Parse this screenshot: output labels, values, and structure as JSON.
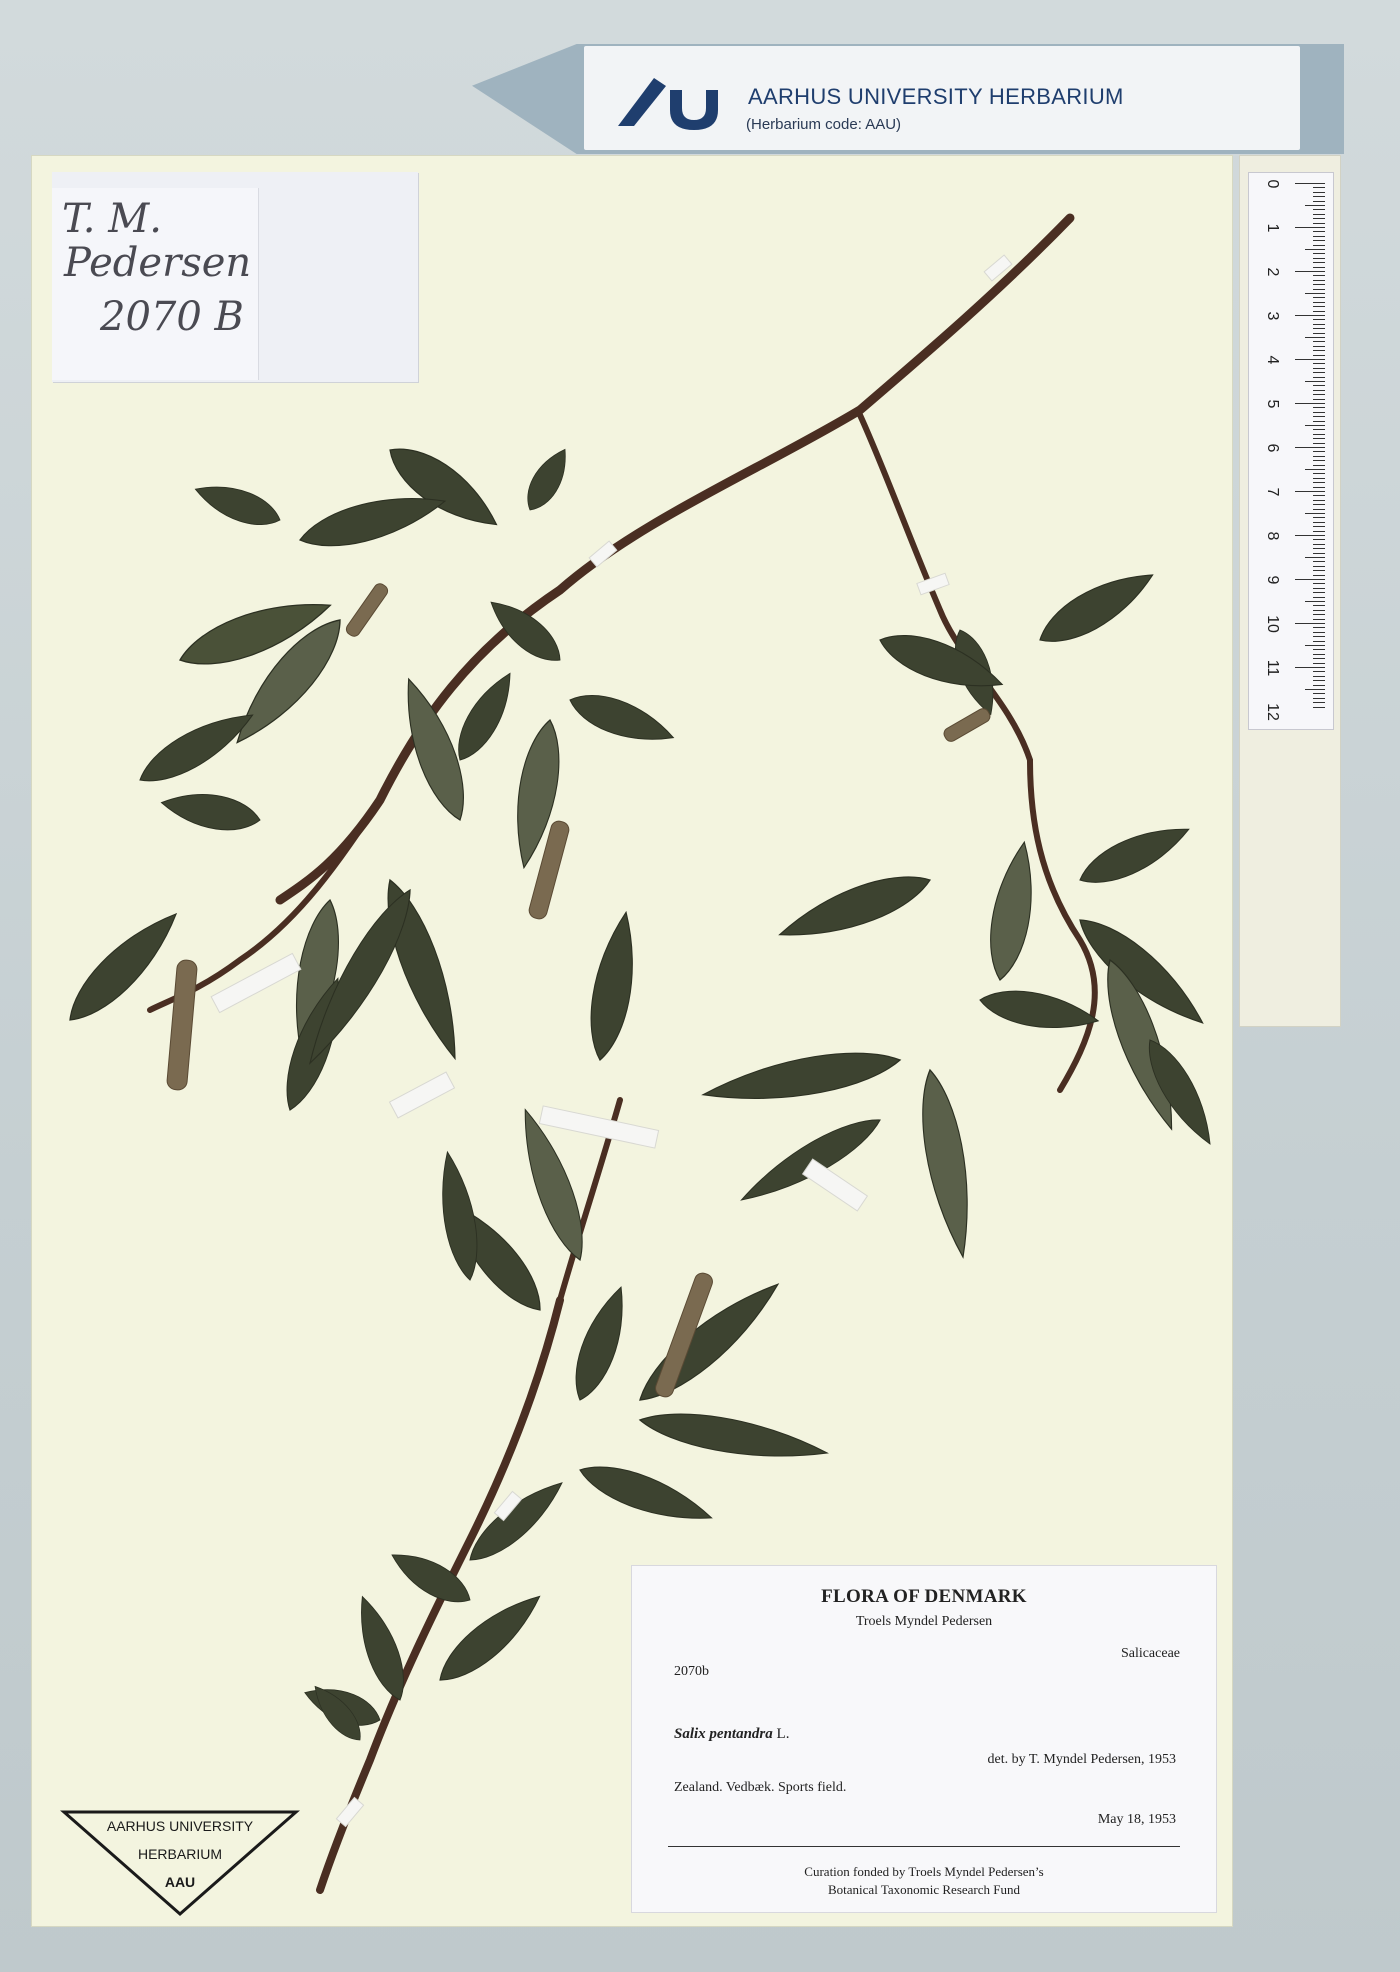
{
  "banner": {
    "title": "AARHUS UNIVERSITY HERBARIUM",
    "code": "(Herbarium code: AAU)",
    "logo_icon": "au-logo-icon"
  },
  "handwritten_tag": {
    "line1": "T. M.",
    "line2": "Pedersen",
    "line3": "2070 B"
  },
  "ruler": {
    "numbers": [
      "0",
      "1",
      "2",
      "3",
      "4",
      "5",
      "6",
      "7",
      "8",
      "9",
      "10",
      "11",
      "12"
    ]
  },
  "label": {
    "title": "FLORA OF DENMARK",
    "collector": "Troels Myndel Pedersen",
    "family": "Salicaceae",
    "number": "2070b",
    "taxon_name": "Salix pentandra",
    "taxon_author": "L.",
    "determination": "det. by T. Myndel Pedersen, 1953",
    "locality": "Zealand. Vedbæk. Sports field.",
    "date": "May 18, 1953",
    "funding_line1": "Curation fonded by Troels Myndel Pedersen’s",
    "funding_line2": "Botanical Taxonomic Research Fund"
  },
  "stamp": {
    "line1": "AARHUS UNIVERSITY",
    "line2": "HERBARIUM",
    "line3": "AAU"
  },
  "colors": {
    "sheet": "#f3f4df",
    "leaf_dark": "#3d4330",
    "leaf_mid": "#5a604a",
    "stem": "#4a2e22",
    "brand_blue": "#1f3e6e"
  }
}
